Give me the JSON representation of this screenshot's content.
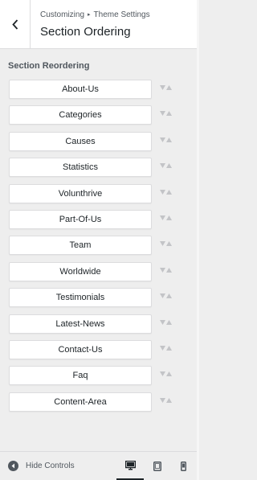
{
  "header": {
    "breadcrumb_root": "Customizing",
    "breadcrumb_leaf": "Theme Settings",
    "title": "Section Ordering"
  },
  "section_label": "Section Reordering",
  "items": [
    {
      "label": "About-Us"
    },
    {
      "label": "Categories"
    },
    {
      "label": "Causes"
    },
    {
      "label": "Statistics"
    },
    {
      "label": "Volunthrive"
    },
    {
      "label": "Part-Of-Us"
    },
    {
      "label": "Team"
    },
    {
      "label": "Worldwide"
    },
    {
      "label": "Testimonials"
    },
    {
      "label": "Latest-News"
    },
    {
      "label": "Contact-Us"
    },
    {
      "label": "Faq"
    },
    {
      "label": "Content-Area"
    }
  ],
  "footer": {
    "hide_controls_label": "Hide Controls",
    "devices": [
      {
        "name": "desktop",
        "active": true
      },
      {
        "name": "tablet",
        "active": false
      },
      {
        "name": "mobile",
        "active": false
      }
    ]
  },
  "colors": {
    "panel_bg": "#eeeeee",
    "item_bg": "#ffffff",
    "arrow": "#c3c4c7",
    "text_dark": "#1d2327",
    "text_muted": "#50575e"
  }
}
